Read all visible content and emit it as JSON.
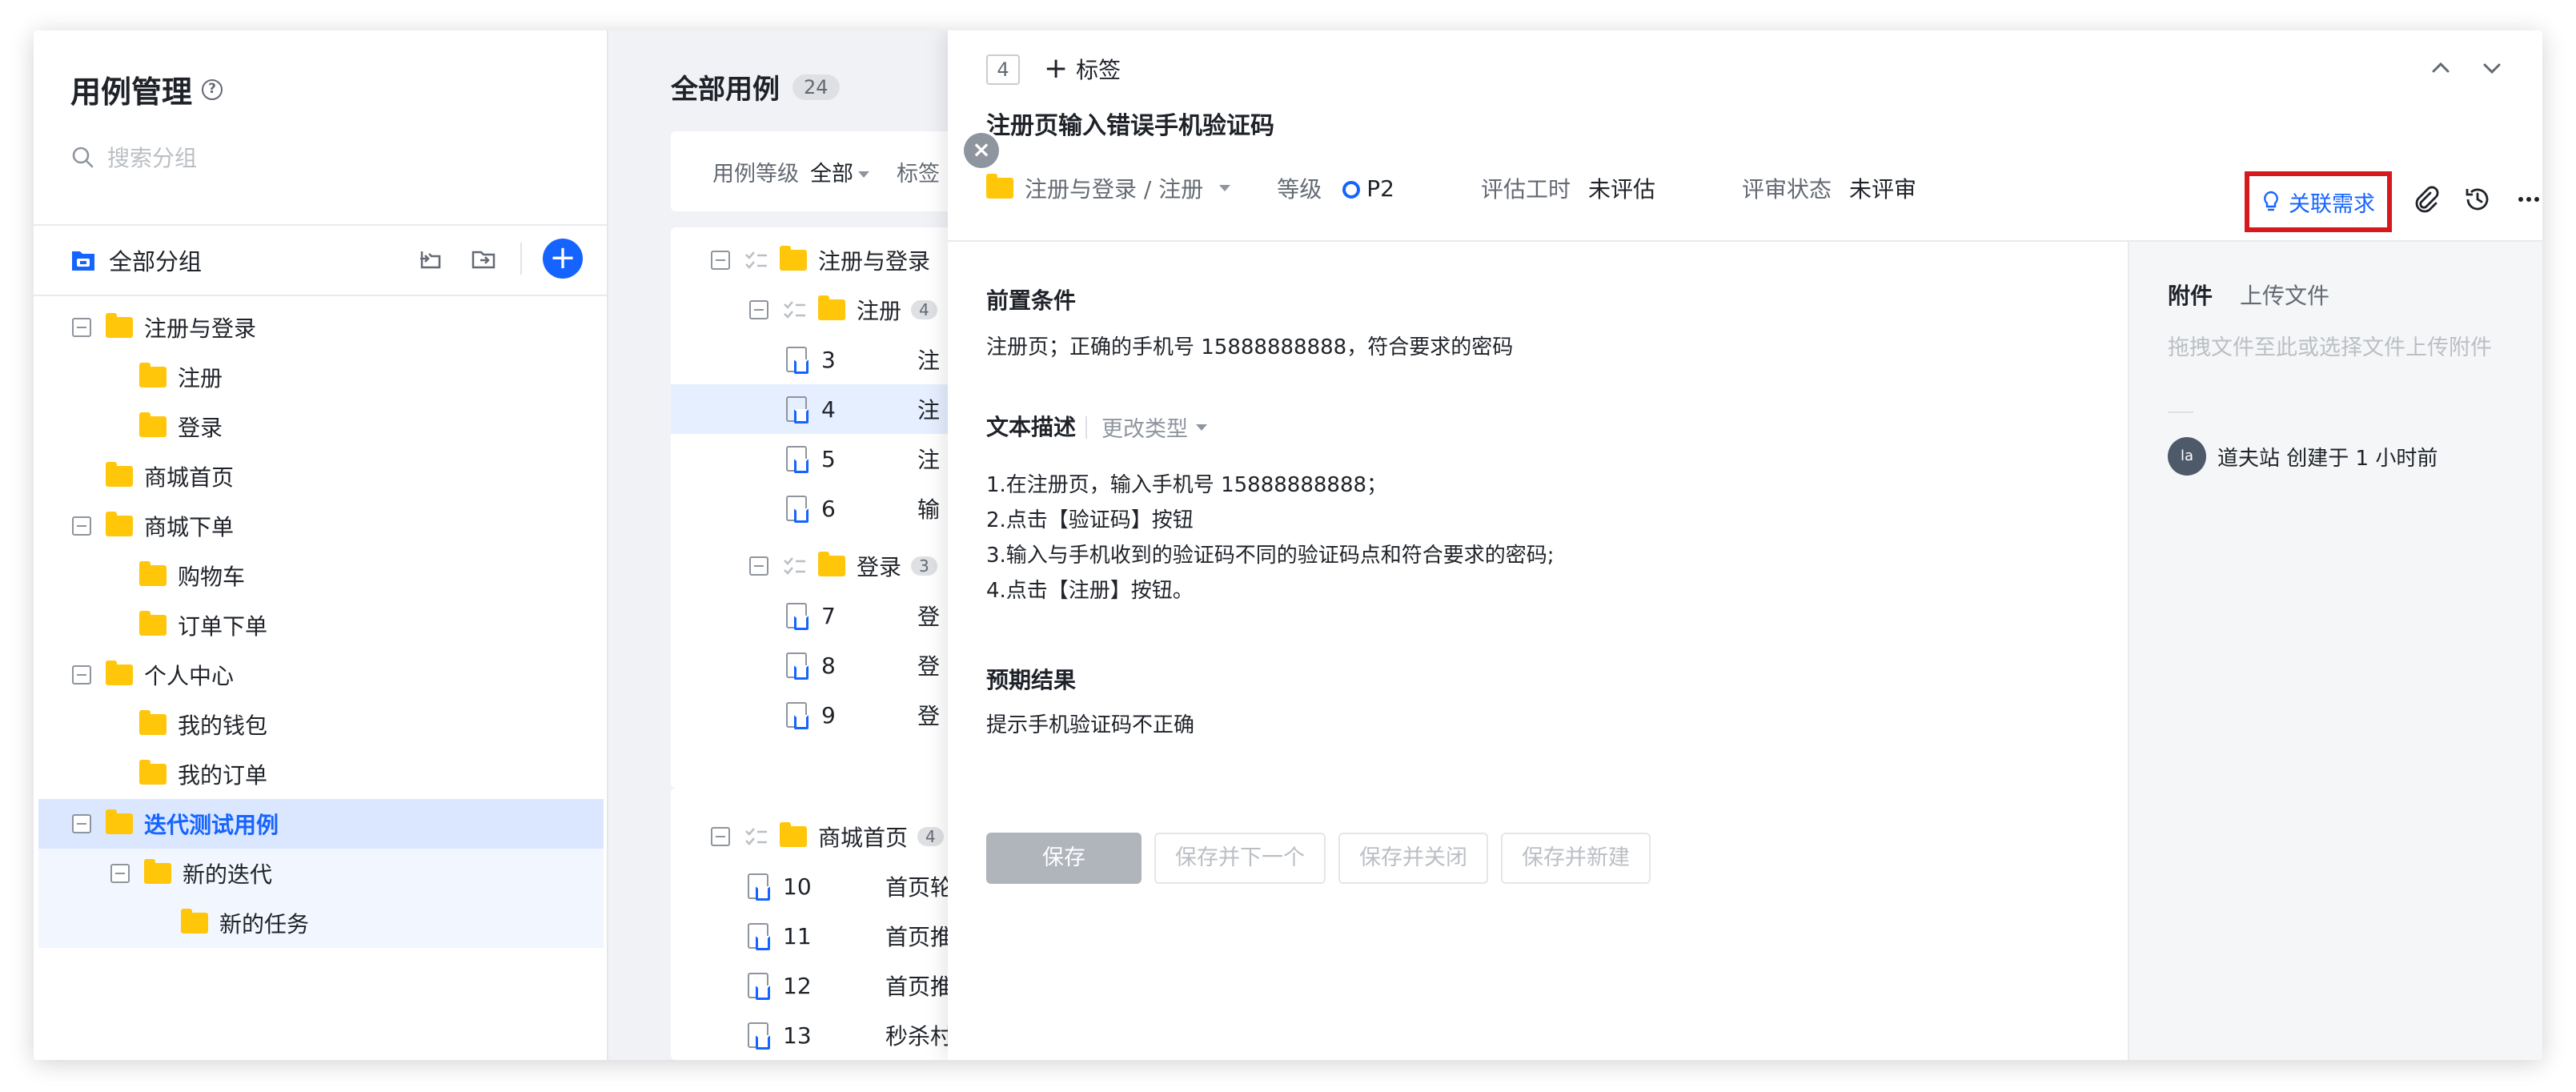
{
  "left": {
    "title": "用例管理",
    "help_icon": "?",
    "search_placeholder": "搜索分组",
    "all_groups": "全部分组",
    "add_icon": "+",
    "tree": [
      {
        "label": "注册与登录"
      },
      {
        "label": "注册"
      },
      {
        "label": "登录"
      },
      {
        "label": "商城首页"
      },
      {
        "label": "商城下单"
      },
      {
        "label": "购物车"
      },
      {
        "label": "订单下单"
      },
      {
        "label": "个人中心"
      },
      {
        "label": "我的钱包"
      },
      {
        "label": "我的订单"
      },
      {
        "label": "迭代测试用例"
      },
      {
        "label": "新的迭代"
      },
      {
        "label": "新的任务"
      }
    ]
  },
  "middle": {
    "title": "全部用例",
    "count": "24",
    "filters": {
      "level_label": "用例等级",
      "level_value": "全部",
      "tag_label": "标签"
    },
    "groups": {
      "g1": {
        "label": "注册与登录"
      },
      "g1a": {
        "label": "注册",
        "count": "4"
      },
      "g1b": {
        "label": "登录",
        "count": "3"
      },
      "g2": {
        "label": "商城首页",
        "count": "4"
      }
    },
    "rows": [
      {
        "id": "3",
        "text": "注"
      },
      {
        "id": "4",
        "text": "注"
      },
      {
        "id": "5",
        "text": "注"
      },
      {
        "id": "6",
        "text": "输"
      },
      {
        "id": "7",
        "text": "登"
      },
      {
        "id": "8",
        "text": "登"
      },
      {
        "id": "9",
        "text": "登"
      },
      {
        "id": "10",
        "text": "首页轮"
      },
      {
        "id": "11",
        "text": "首页推"
      },
      {
        "id": "12",
        "text": "首页推"
      },
      {
        "id": "13",
        "text": "秒杀村"
      }
    ]
  },
  "close_icon": "×",
  "detail": {
    "id": "4",
    "add_tag": "标签",
    "title": "注册页输入错误手机验证码",
    "breadcrumb": "注册与登录 / 注册",
    "level_label": "等级",
    "level_value": "P2",
    "estimate_label": "评估工时",
    "estimate_value": "未评估",
    "review_label": "评审状态",
    "review_value": "未评审",
    "link_requirement": "关联需求",
    "precondition_title": "前置条件",
    "precondition_text": "注册页；正确的手机号 15888888888，符合要求的密码",
    "desc_title": "文本描述",
    "change_type": "更改类型",
    "steps": [
      "1.在注册页，输入手机号 15888888888；",
      "2.点击【验证码】按钮",
      "3.输入与手机收到的验证码不同的验证码点和符合要求的密码;",
      "4.点击【注册】按钮。"
    ],
    "expected_title": "预期结果",
    "expected_text": "提示手机验证码不正确",
    "buttons": {
      "save": "保存",
      "save_next": "保存并下一个",
      "save_close": "保存并关闭",
      "save_new": "保存并新建"
    },
    "side": {
      "tab_attach": "附件",
      "tab_upload": "上传文件",
      "hint": "拖拽文件至此或选择文件上传附件",
      "avatar": "la",
      "log": "道夫站 创建于 1 小时前"
    }
  }
}
